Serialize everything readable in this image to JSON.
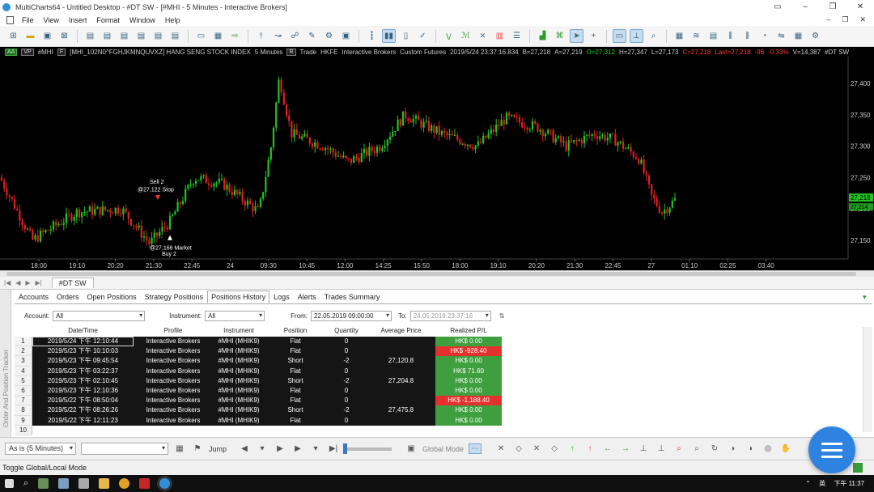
{
  "window": {
    "title": "MultiCharts64 - Untitled Desktop - #DT SW - [#MHI - 5 Minutes - Interactive Brokers]"
  },
  "menu": [
    "File",
    "View",
    "Insert",
    "Format",
    "Window",
    "Help"
  ],
  "chart_header": {
    "aa": "AA",
    "vp": "VP",
    "sym": "#MHI",
    "f": "F",
    "contract": "[MHI_102N0^FGHJKMNQUVXZ] HANG SENG STOCK INDEX",
    "interval": "5 Minutes",
    "r": "R",
    "mode": "Trade",
    "exchange": "HKFE",
    "broker": "Interactive Brokers",
    "type": "Custom Futures",
    "datetime": "2019/5/24 23:37:16.834",
    "bid": "B=27,218",
    "ask": "A=27,219",
    "open": "O=27,312",
    "high": "H=27,347",
    "low": "L=27,173",
    "close": "C=27,218",
    "last": "Last=27,218",
    "chg": "-96",
    "pct": "-0.33%",
    "vol": "V=14,387",
    "desk": "#DT SW"
  },
  "chart_data": {
    "type": "candlestick",
    "price_ticks": [
      "27,400",
      "27,350",
      "27,300",
      "27,250",
      "27,200",
      "27,150"
    ],
    "time_ticks": [
      "18:00",
      "19:10",
      "20:20",
      "21:30",
      "22:45",
      "24",
      "09:30",
      "10:45",
      "12:00",
      "14:25",
      "15:50",
      "18:00",
      "19:10",
      "20:20",
      "21:30",
      "22:45",
      "27",
      "01:10",
      "02:25",
      "03:40"
    ],
    "last_price": "27,218",
    "last_price_2": "27,214",
    "trades": [
      {
        "label": "Sell 2",
        "price": "@27,122 Stop"
      },
      {
        "label": "Buy 2",
        "price": "@27,166 Market"
      }
    ]
  },
  "desktop_tab": "#DT SW",
  "tracker": {
    "side_label": "Order And Position Tracker",
    "tabs": [
      "Accounts",
      "Orders",
      "Open Positions",
      "Strategy Positions",
      "Positions History",
      "Logs",
      "Alerts",
      "Trades Summary"
    ],
    "active_tab": "Positions History",
    "filters": {
      "account_label": "Account:",
      "account_value": "All",
      "instrument_label": "Instrument:",
      "instrument_value": "All",
      "from_label": "From:",
      "from_value": "22.05.2019 09:00:00",
      "to_label": "To:",
      "to_value": "24.05.2019 23:37:16"
    },
    "columns": [
      "Date/Time",
      "Profile",
      "Instrument",
      "Position",
      "Quantity",
      "Average Price",
      "Realized P/L"
    ],
    "rows": [
      {
        "n": "1",
        "dt": "2019/5/24 下午 12:10:44",
        "profile": "Interactive Brokers",
        "instr": "#MHI (MHIK9)",
        "pos": "Flat",
        "qty": "0",
        "avg": "",
        "pl": "HK$ 0.00",
        "neg": false
      },
      {
        "n": "2",
        "dt": "2019/5/23 下午 10:10:03",
        "profile": "Interactive Brokers",
        "instr": "#MHI (MHIK9)",
        "pos": "Flat",
        "qty": "0",
        "avg": "",
        "pl": "HK$ -928.40",
        "neg": true
      },
      {
        "n": "3",
        "dt": "2019/5/23 下午 09:45:54",
        "profile": "Interactive Brokers",
        "instr": "#MHI (MHIK9)",
        "pos": "Short",
        "qty": "-2",
        "avg": "27,120.8",
        "pl": "HK$ 0.00",
        "neg": false
      },
      {
        "n": "4",
        "dt": "2019/5/23 下午 03:22:37",
        "profile": "Interactive Brokers",
        "instr": "#MHI (MHIK9)",
        "pos": "Flat",
        "qty": "0",
        "avg": "",
        "pl": "HK$ 71.60",
        "neg": false
      },
      {
        "n": "5",
        "dt": "2019/5/23 下午 02:10:45",
        "profile": "Interactive Brokers",
        "instr": "#MHI (MHIK9)",
        "pos": "Short",
        "qty": "-2",
        "avg": "27,204.8",
        "pl": "HK$ 0.00",
        "neg": false
      },
      {
        "n": "6",
        "dt": "2019/5/23 下午 12:10:36",
        "profile": "Interactive Brokers",
        "instr": "#MHI (MHIK9)",
        "pos": "Flat",
        "qty": "0",
        "avg": "",
        "pl": "HK$ 0.00",
        "neg": false
      },
      {
        "n": "7",
        "dt": "2019/5/22 下午 08:50:04",
        "profile": "Interactive Brokers",
        "instr": "#MHI (MHIK9)",
        "pos": "Flat",
        "qty": "0",
        "avg": "",
        "pl": "HK$ -1,188.40",
        "neg": true
      },
      {
        "n": "8",
        "dt": "2019/5/22 下午 08:26:26",
        "profile": "Interactive Brokers",
        "instr": "#MHI (MHIK9)",
        "pos": "Short",
        "qty": "-2",
        "avg": "27,475.8",
        "pl": "HK$ 0.00",
        "neg": false
      },
      {
        "n": "9",
        "dt": "2019/5/22 下午 12:11:23",
        "profile": "Interactive Brokers",
        "instr": "#MHI (MHIK9)",
        "pos": "Flat",
        "qty": "0",
        "avg": "",
        "pl": "HK$ 0.00",
        "neg": false
      },
      {
        "n": "10",
        "dt": "",
        "profile": "",
        "instr": "",
        "pos": "",
        "qty": "",
        "avg": "",
        "pl": "",
        "neg": false
      }
    ]
  },
  "bottombar": {
    "resolution": "As is (5 Minutes)",
    "jump": "Jump",
    "global_mode": "Global Mode"
  },
  "status": "Toggle Global/Local Mode",
  "taskbar": {
    "lang": "英",
    "clock": "下午 11:37"
  },
  "colors": {
    "up": "#22c322",
    "down": "#e02020",
    "pl_green": "#3f9f3f",
    "pl_red": "#e5312e",
    "fab": "#2f83e0"
  }
}
